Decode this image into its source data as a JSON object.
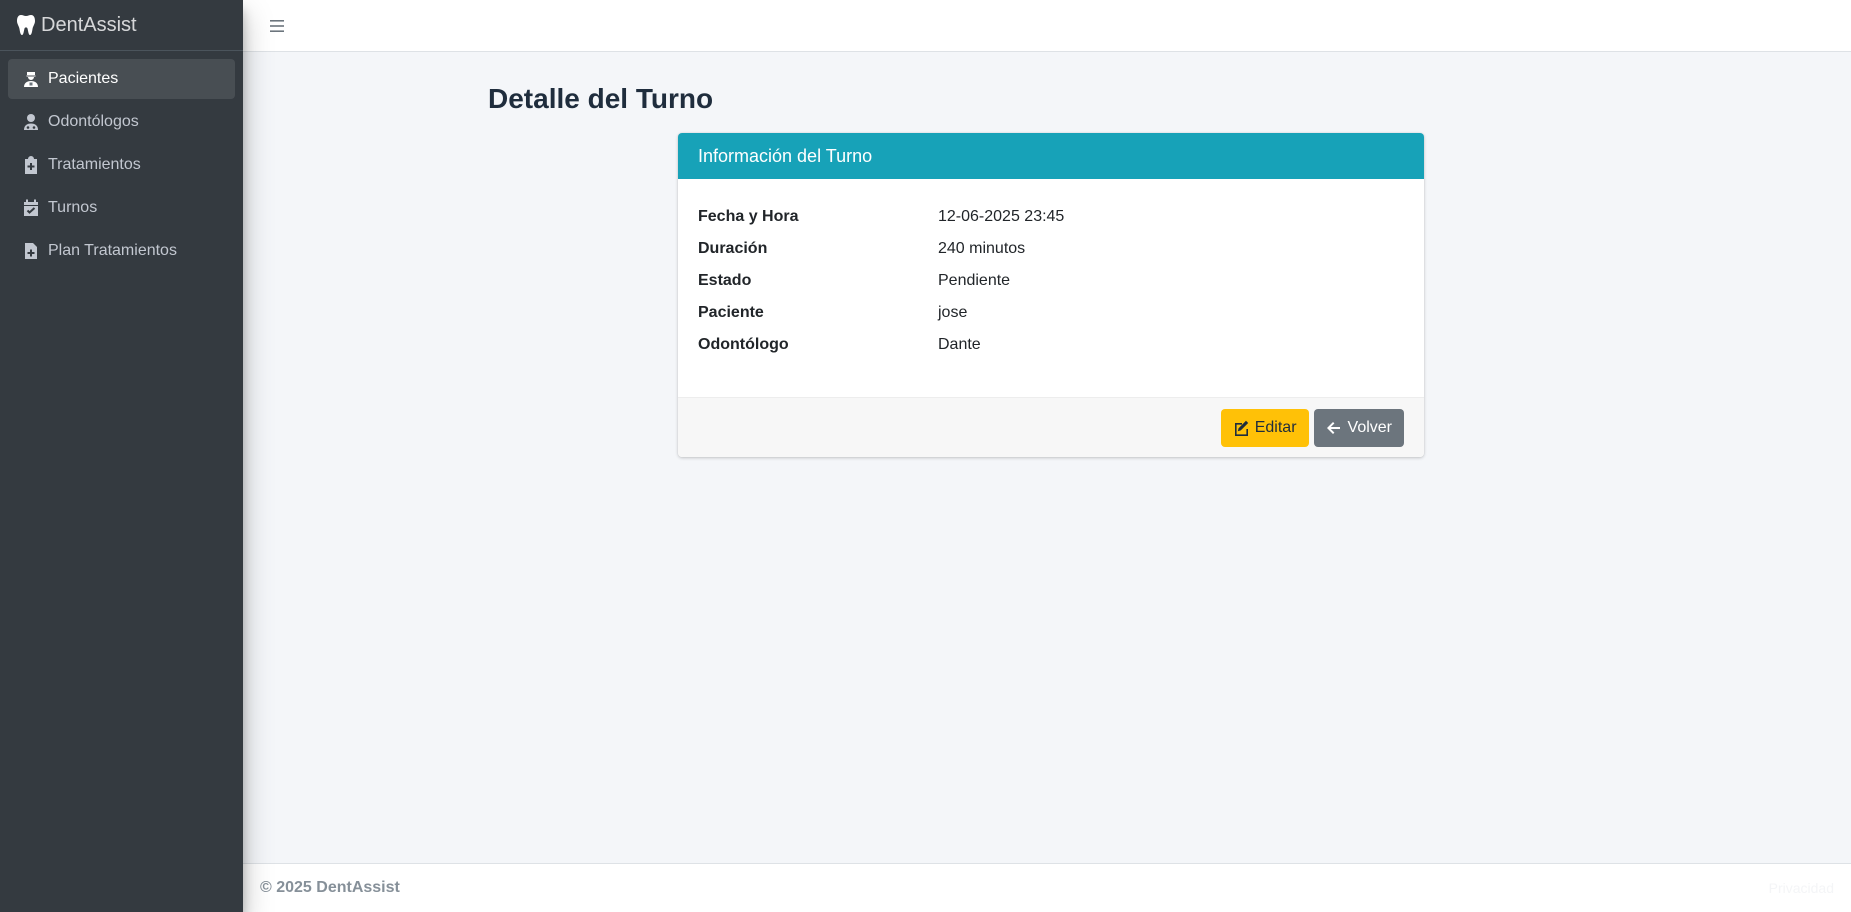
{
  "app": {
    "brand": "DentAssist"
  },
  "sidebar": {
    "items": [
      {
        "label": "Pacientes",
        "icon": "patient-icon",
        "active": true
      },
      {
        "label": "Odontólogos",
        "icon": "doctor-icon",
        "active": false
      },
      {
        "label": "Tratamientos",
        "icon": "clipboard-plus-icon",
        "active": false
      },
      {
        "label": "Turnos",
        "icon": "calendar-check-icon",
        "active": false
      },
      {
        "label": "Plan Tratamientos",
        "icon": "file-medical-icon",
        "active": false
      }
    ]
  },
  "page": {
    "title": "Detalle del Turno"
  },
  "card": {
    "header": "Información del Turno",
    "rows": [
      {
        "label": "Fecha y Hora",
        "value": "12-06-2025 23:45"
      },
      {
        "label": "Duración",
        "value": "240 minutos"
      },
      {
        "label": "Estado",
        "value": "Pendiente"
      },
      {
        "label": "Paciente",
        "value": "jose"
      },
      {
        "label": "Odontólogo",
        "value": "Dante"
      }
    ],
    "buttons": {
      "edit_label": "Editar",
      "back_label": "Volver"
    }
  },
  "footer": {
    "copyright": "© 2025 DentAssist",
    "right_text": "Privacidad"
  },
  "colors": {
    "sidebar_bg": "#343a40",
    "header_accent": "#17a2b8",
    "warning": "#ffc107",
    "secondary": "#6c757d",
    "content_bg": "#f4f6f9"
  }
}
